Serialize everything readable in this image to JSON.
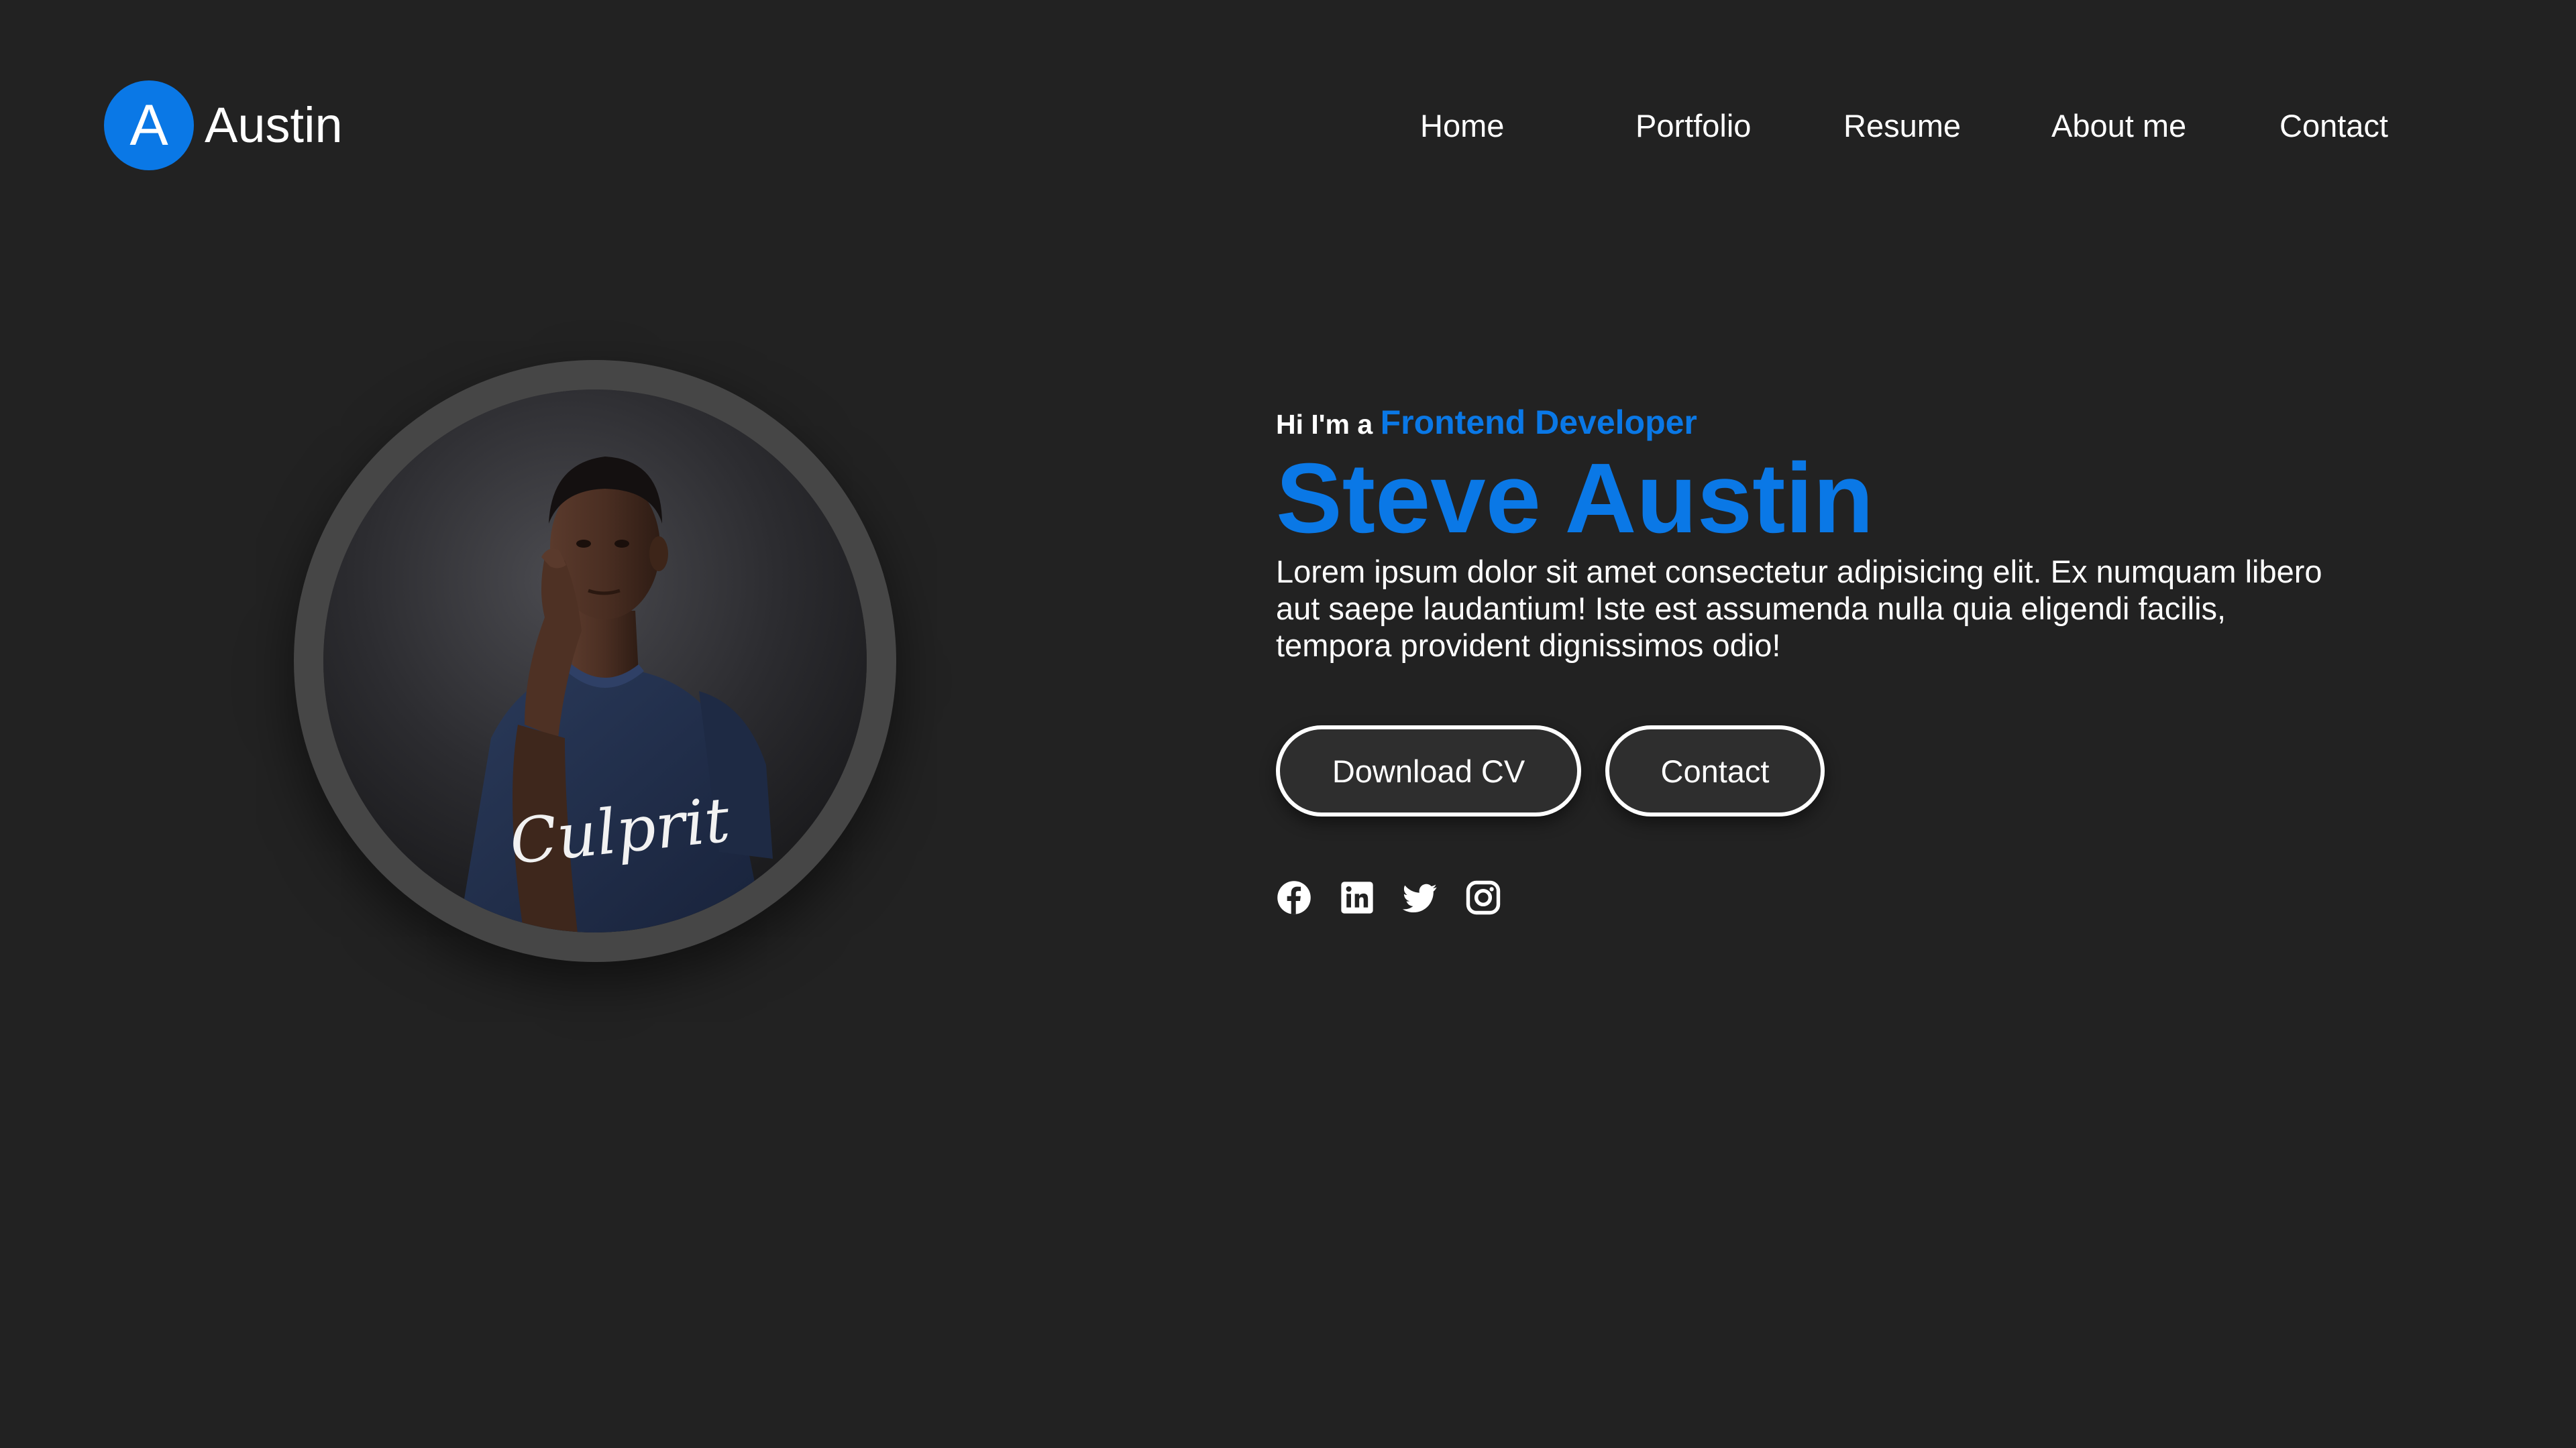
{
  "header": {
    "logo_letter": "A",
    "logo_name": "Austin",
    "nav": {
      "home": "Home",
      "portfolio": "Portfolio",
      "resume": "Resume",
      "about": "About me",
      "contact": "Contact"
    }
  },
  "hero": {
    "intro_prefix": "Hi I'm a",
    "intro_role": "Frontend Developer",
    "name": "Steve Austin",
    "description": "Lorem ipsum dolor sit amet consectetur adipisicing elit. Ex numquam libero aut saepe laudantium! Iste est assumenda nulla quia eligendi facilis, tempora provident dignissimos odio!",
    "buttons": {
      "download_cv": "Download CV",
      "contact": "Contact"
    },
    "shirt_text": "Culprit"
  },
  "socials": [
    "facebook-icon",
    "linkedin-icon",
    "twitter-icon",
    "instagram-icon"
  ],
  "colors": {
    "background": "#222222",
    "accent": "#0a78e6",
    "text": "#ffffff",
    "ring": "#464646",
    "button_bg": "#2e2e2e"
  }
}
